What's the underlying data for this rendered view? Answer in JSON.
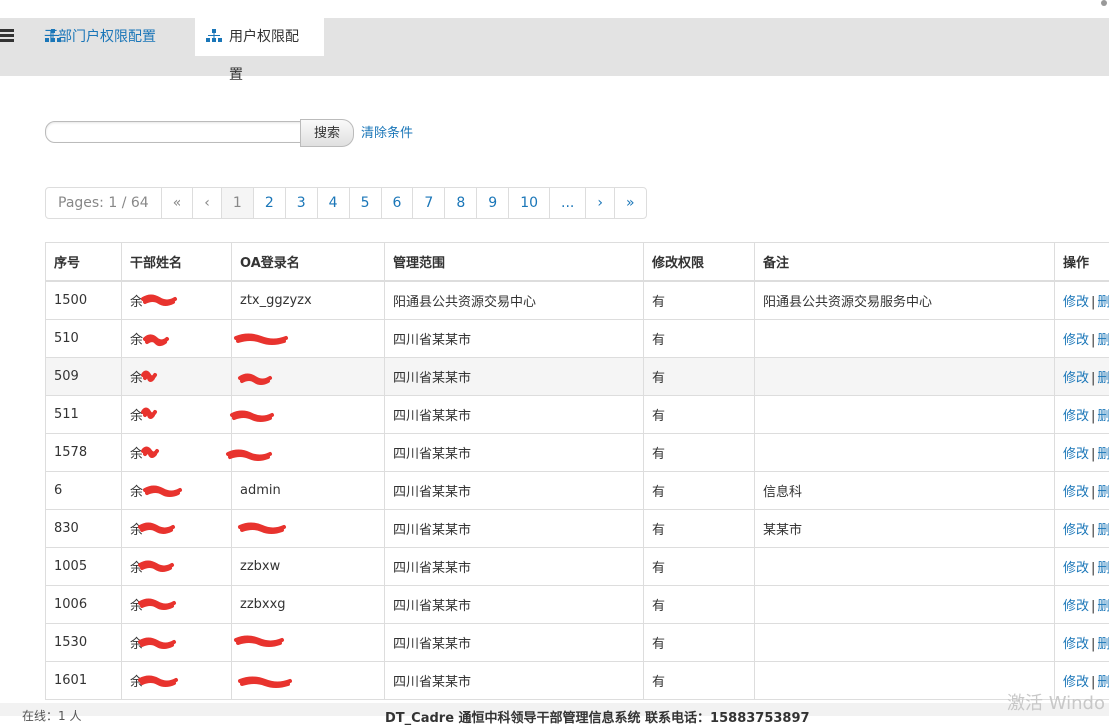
{
  "tabs": [
    {
      "label": "干部门户权限配置"
    },
    {
      "label": "用户权限配置"
    }
  ],
  "search": {
    "value": "",
    "placeholder": "",
    "button_label": "搜索",
    "clear_label": "清除条件"
  },
  "pagination": {
    "info": "Pages: 1 / 64",
    "first": "«",
    "prev": "‹",
    "pages": [
      "1",
      "2",
      "3",
      "4",
      "5",
      "6",
      "7",
      "8",
      "9",
      "10"
    ],
    "current": "1",
    "ellipsis": "...",
    "next": "›",
    "last": "»"
  },
  "table": {
    "headers": [
      "序号",
      "干部姓名",
      "OA登录名",
      "管理范围",
      "修改权限",
      "备注",
      "操作"
    ],
    "rows": [
      {
        "no": "1500",
        "name": "余",
        "oa": "ztx_ggzyzx",
        "scope": "阳通县公共资源交易中心",
        "perm": "有",
        "note": "阳通县公共资源交易服务中心"
      },
      {
        "no": "510",
        "name": "余",
        "oa": "",
        "scope": "四川省某某市",
        "perm": "有",
        "note": ""
      },
      {
        "no": "509",
        "name": "余",
        "oa": "",
        "scope": "四川省某某市",
        "perm": "有",
        "note": ""
      },
      {
        "no": "511",
        "name": "余",
        "oa": "",
        "scope": "四川省某某市",
        "perm": "有",
        "note": ""
      },
      {
        "no": "1578",
        "name": "余",
        "oa": "",
        "scope": "四川省某某市",
        "perm": "有",
        "note": ""
      },
      {
        "no": "6",
        "name": "余",
        "oa": "admin",
        "scope": "四川省某某市",
        "perm": "有",
        "note": "信息科"
      },
      {
        "no": "830",
        "name": "余",
        "oa": "",
        "scope": "四川省某某市",
        "perm": "有",
        "note": "某某市"
      },
      {
        "no": "1005",
        "name": "余",
        "oa": "zzbxw",
        "scope": "四川省某某市",
        "perm": "有",
        "note": ""
      },
      {
        "no": "1006",
        "name": "余",
        "oa": "zzbxxg",
        "scope": "四川省某某市",
        "perm": "有",
        "note": ""
      },
      {
        "no": "1530",
        "name": "余",
        "oa": "",
        "scope": "四川省某某市",
        "perm": "有",
        "note": ""
      },
      {
        "no": "1601",
        "name": "余",
        "oa": "",
        "scope": "四川省某某市",
        "perm": "有",
        "note": ""
      }
    ],
    "action_edit": "修改",
    "action_sep": "|",
    "action_delete": "删"
  },
  "footer": {
    "left": "在线：1 人",
    "text": "DT_Cadre 通恒中科领导干部管理信息系统 联系电话：15883753897"
  },
  "watermark": "激活 Windo",
  "colors": {
    "link": "#1a76b8",
    "redaction": "#e8332e"
  }
}
